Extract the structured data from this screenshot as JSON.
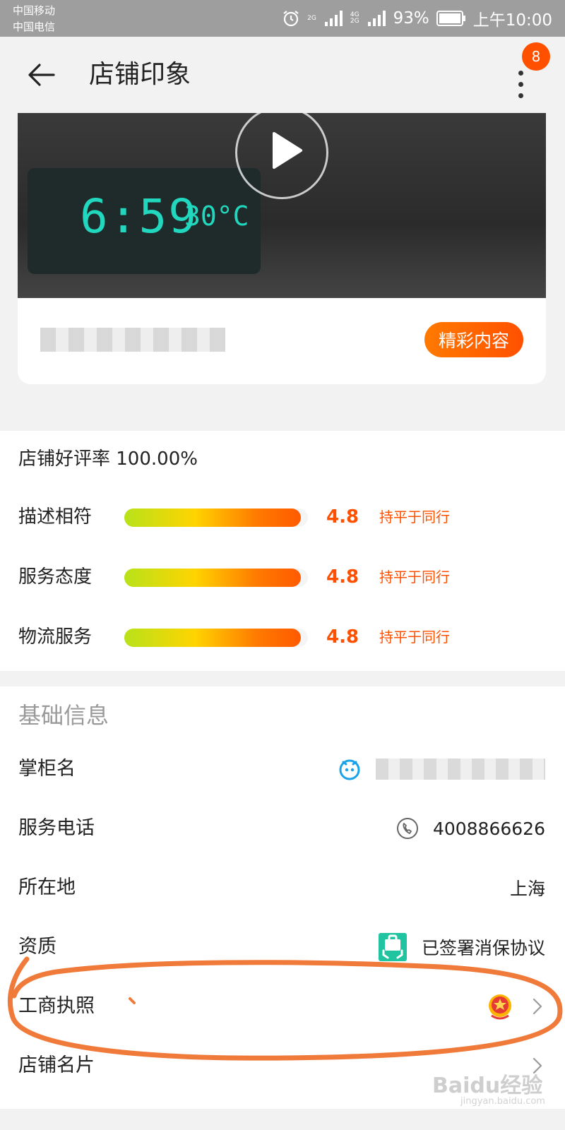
{
  "status_bar": {
    "carrier_1": "中国移动",
    "carrier_2": "中国电信",
    "net_1": "2G",
    "net_2": "4G",
    "net_3": "2G",
    "battery": "93%",
    "time": "上午10:00",
    "icons": [
      "alarm-icon",
      "signal-icon",
      "signal-icon",
      "battery-icon"
    ]
  },
  "app_bar": {
    "title": "店铺印象",
    "back_icon": "arrow-left-icon",
    "more_icon": "more-vertical-icon",
    "badge_count": "8"
  },
  "video_card": {
    "clock_time": "6:59",
    "clock_temp": "30°C",
    "play_icon": "play-icon",
    "highlight_button": "精彩内容"
  },
  "ratings": {
    "title": "店铺好评率 100.00%",
    "items": [
      {
        "label": "描述相符",
        "score": "4.8",
        "level": 0.96,
        "compare": "持平于同行"
      },
      {
        "label": "服务态度",
        "score": "4.8",
        "level": 0.96,
        "compare": "持平于同行"
      },
      {
        "label": "物流服务",
        "score": "4.8",
        "level": 0.96,
        "compare": "持平于同行"
      }
    ]
  },
  "basic_info": {
    "title": "基础信息",
    "rows": [
      {
        "label": "掌柜名",
        "icon": "wangwang-chat-icon"
      },
      {
        "label": "服务电话",
        "value": "4008866626",
        "icon": "phone-icon"
      },
      {
        "label": "所在地",
        "value": "上海"
      },
      {
        "label": "资质",
        "value": "已签署消保协议",
        "icon": "consumer-protection-icon"
      },
      {
        "label": "工商执照",
        "icon": "business-license-emblem-icon"
      },
      {
        "label": "店铺名片"
      }
    ]
  },
  "watermark": {
    "brand": "Baidu经验",
    "url": "jingyan.baidu.com"
  },
  "colors": {
    "accent": "#ff5000",
    "annotation": "#f07a3a",
    "status_bar": "#9e9e9e",
    "clock_digits": "#21d8bf"
  }
}
